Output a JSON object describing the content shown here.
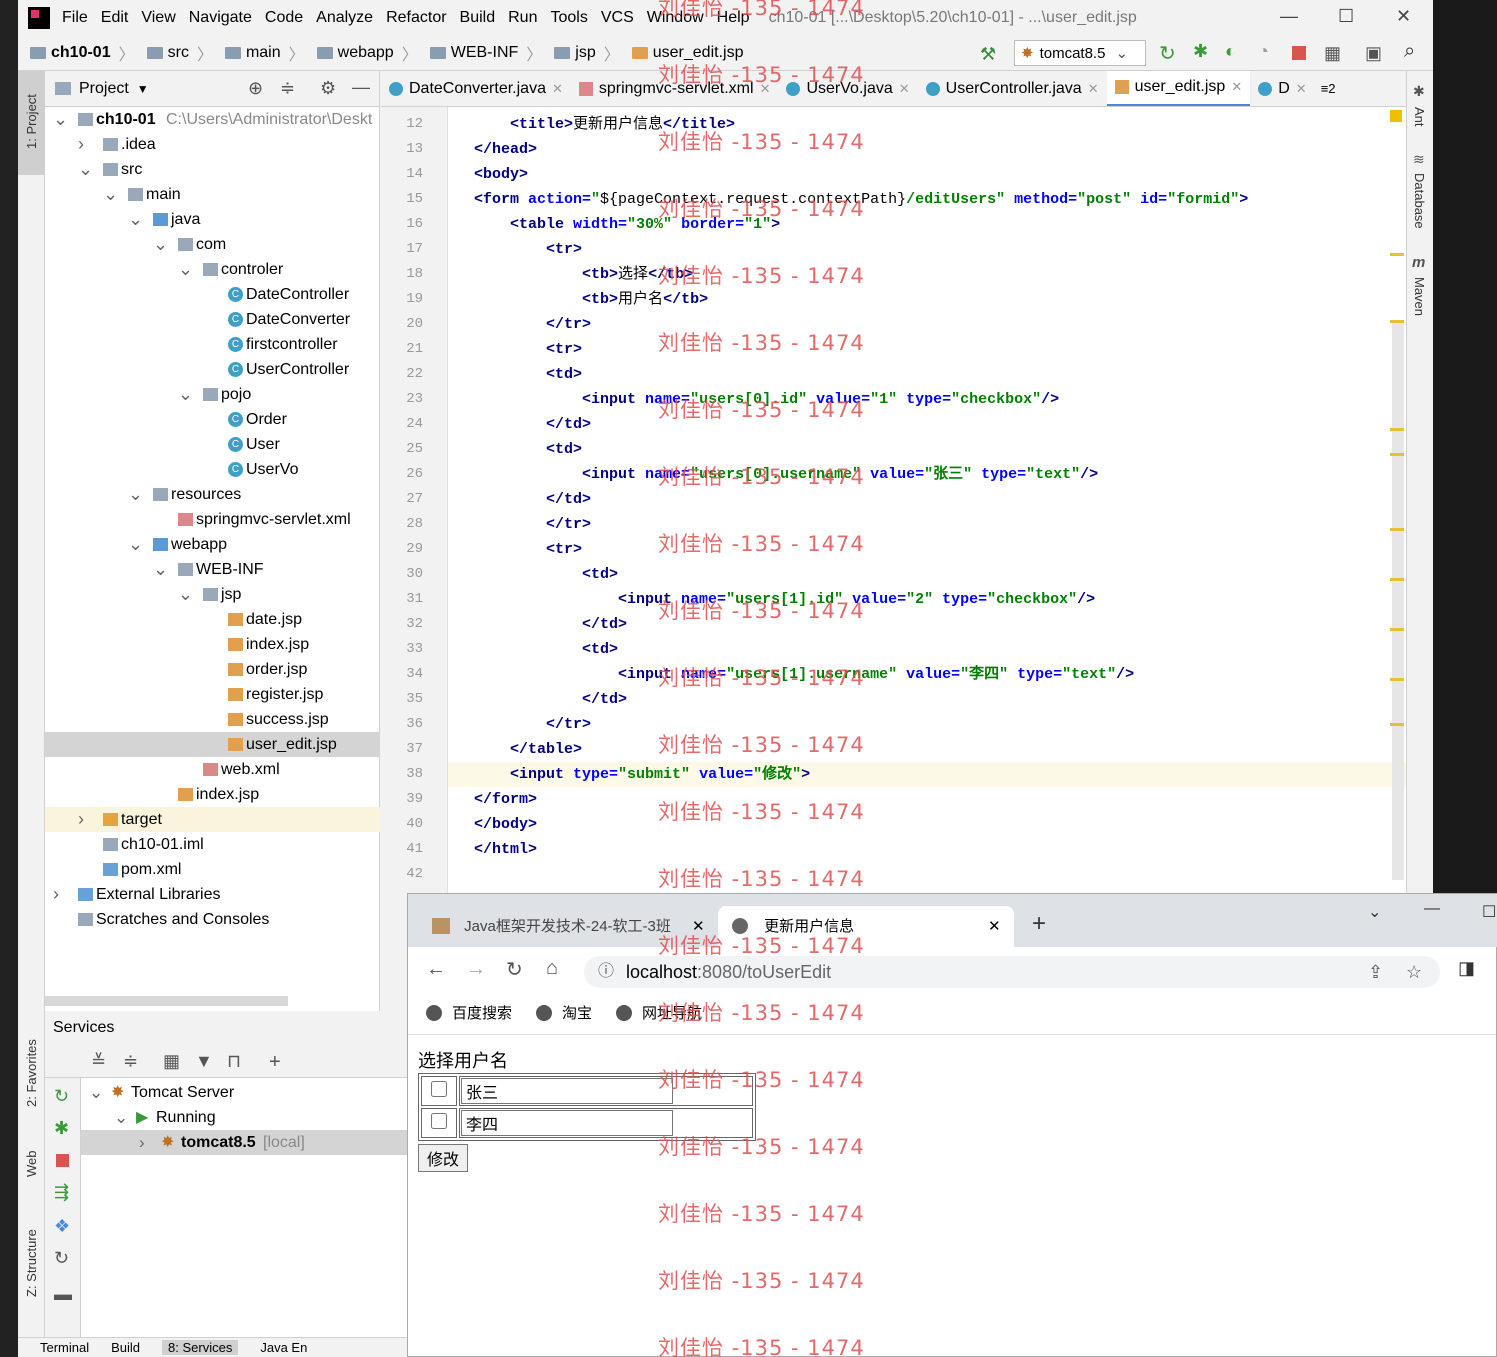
{
  "menubar": {
    "items": [
      "File",
      "Edit",
      "View",
      "Navigate",
      "Code",
      "Analyze",
      "Refactor",
      "Build",
      "Run",
      "Tools",
      "VCS",
      "Window",
      "Help"
    ],
    "title": "ch10-01 [...\\Desktop\\5.20\\ch10-01] - ...\\user_edit.jsp"
  },
  "breadcrumb": [
    "ch10-01",
    "src",
    "main",
    "webapp",
    "WEB-INF",
    "jsp",
    "user_edit.jsp"
  ],
  "run_config": "tomcat8.5",
  "project_panel": {
    "title": "Project",
    "tree": [
      {
        "label": "ch10-01",
        "extra": "C:\\Users\\Administrator\\Deskt",
        "indent": 0,
        "arrow": "v",
        "icon": "folder",
        "bold": true
      },
      {
        "label": ".idea",
        "indent": 1,
        "arrow": ">",
        "icon": "folder"
      },
      {
        "label": "src",
        "indent": 1,
        "arrow": "v",
        "icon": "folder"
      },
      {
        "label": "main",
        "indent": 2,
        "arrow": "v",
        "icon": "folder"
      },
      {
        "label": "java",
        "indent": 3,
        "arrow": "v",
        "icon": "folder-blue"
      },
      {
        "label": "com",
        "indent": 4,
        "arrow": "v",
        "icon": "folder"
      },
      {
        "label": "controler",
        "indent": 5,
        "arrow": "v",
        "icon": "folder"
      },
      {
        "label": "DateController",
        "indent": 6,
        "icon": "class"
      },
      {
        "label": "DateConverter",
        "indent": 6,
        "icon": "class"
      },
      {
        "label": "firstcontroller",
        "indent": 6,
        "icon": "class"
      },
      {
        "label": "UserController",
        "indent": 6,
        "icon": "class"
      },
      {
        "label": "pojo",
        "indent": 5,
        "arrow": "v",
        "icon": "folder"
      },
      {
        "label": "Order",
        "indent": 6,
        "icon": "class"
      },
      {
        "label": "User",
        "indent": 6,
        "icon": "class"
      },
      {
        "label": "UserVo",
        "indent": 6,
        "icon": "class"
      },
      {
        "label": "resources",
        "indent": 3,
        "arrow": "v",
        "icon": "folder"
      },
      {
        "label": "springmvc-servlet.xml",
        "indent": 4,
        "icon": "xml"
      },
      {
        "label": "webapp",
        "indent": 3,
        "arrow": "v",
        "icon": "folder-blue"
      },
      {
        "label": "WEB-INF",
        "indent": 4,
        "arrow": "v",
        "icon": "folder"
      },
      {
        "label": "jsp",
        "indent": 5,
        "arrow": "v",
        "icon": "folder"
      },
      {
        "label": "date.jsp",
        "indent": 6,
        "icon": "jsp"
      },
      {
        "label": "index.jsp",
        "indent": 6,
        "icon": "jsp"
      },
      {
        "label": "order.jsp",
        "indent": 6,
        "icon": "jsp"
      },
      {
        "label": "register.jsp",
        "indent": 6,
        "icon": "jsp"
      },
      {
        "label": "success.jsp",
        "indent": 6,
        "icon": "jsp"
      },
      {
        "label": "user_edit.jsp",
        "indent": 6,
        "icon": "jsp",
        "selected": true
      },
      {
        "label": "web.xml",
        "indent": 5,
        "icon": "xml"
      },
      {
        "label": "index.jsp",
        "indent": 4,
        "icon": "jsp"
      },
      {
        "label": "target",
        "indent": 1,
        "arrow": ">",
        "icon": "folder-orange",
        "target": true
      },
      {
        "label": "ch10-01.iml",
        "indent": 1,
        "icon": "file"
      },
      {
        "label": "pom.xml",
        "indent": 1,
        "icon": "maven"
      },
      {
        "label": "External Libraries",
        "indent": 0,
        "arrow": ">",
        "icon": "lib"
      },
      {
        "label": "Scratches and Consoles",
        "indent": 0,
        "icon": "scratch"
      }
    ]
  },
  "editor_tabs": [
    {
      "label": "DateConverter.java",
      "icon": "class"
    },
    {
      "label": "springmvc-servlet.xml",
      "icon": "xml"
    },
    {
      "label": "UserVo.java",
      "icon": "class"
    },
    {
      "label": "UserController.java",
      "icon": "class"
    },
    {
      "label": "user_edit.jsp",
      "icon": "jsp",
      "active": true
    },
    {
      "label": "D",
      "icon": "class"
    }
  ],
  "tabs_overflow": "≡2",
  "code_lines": [
    {
      "n": "12",
      "segs": [
        [
          "i",
          "    "
        ],
        [
          "tag",
          "<title>"
        ],
        [
          "txt",
          "更新用户信息"
        ],
        [
          "tag",
          "</title>"
        ]
      ]
    },
    {
      "n": "13",
      "segs": [
        [
          "tag",
          "</head>"
        ]
      ]
    },
    {
      "n": "14",
      "segs": [
        [
          "tag",
          "<body>"
        ]
      ]
    },
    {
      "n": "15",
      "segs": [
        [
          "tag",
          "<form "
        ],
        [
          "attr",
          "action="
        ],
        [
          "val",
          "\""
        ],
        [
          "txt",
          "${pageContext.request.contextPath}"
        ],
        [
          "val",
          "/editUsers\" "
        ],
        [
          "attr",
          "method="
        ],
        [
          "val",
          "\"post\" "
        ],
        [
          "attr",
          "id="
        ],
        [
          "val",
          "\"formid\""
        ],
        [
          "tag",
          ">"
        ]
      ]
    },
    {
      "n": "16",
      "segs": [
        [
          "i",
          "    "
        ],
        [
          "tag",
          "<table "
        ],
        [
          "attr",
          "width="
        ],
        [
          "val",
          "\"30%\" "
        ],
        [
          "attr",
          "border="
        ],
        [
          "val",
          "\"1\""
        ],
        [
          "tag",
          ">"
        ]
      ]
    },
    {
      "n": "17",
      "segs": [
        [
          "i",
          "        "
        ],
        [
          "tag",
          "<tr>"
        ]
      ]
    },
    {
      "n": "18",
      "segs": [
        [
          "i",
          "            "
        ],
        [
          "tag",
          "<tb>"
        ],
        [
          "txt",
          "选择"
        ],
        [
          "tag",
          "</tb>"
        ]
      ]
    },
    {
      "n": "19",
      "segs": [
        [
          "i",
          "            "
        ],
        [
          "tag",
          "<tb>"
        ],
        [
          "txt",
          "用户名"
        ],
        [
          "tag",
          "</tb>"
        ]
      ]
    },
    {
      "n": "20",
      "segs": [
        [
          "i",
          "        "
        ],
        [
          "tag",
          "</tr>"
        ]
      ]
    },
    {
      "n": "21",
      "segs": [
        [
          "i",
          "        "
        ],
        [
          "tag",
          "<tr>"
        ]
      ]
    },
    {
      "n": "22",
      "segs": [
        [
          "i",
          "        "
        ],
        [
          "tag",
          "<td>"
        ]
      ]
    },
    {
      "n": "23",
      "segs": [
        [
          "i",
          "            "
        ],
        [
          "tag",
          "<input "
        ],
        [
          "attr",
          "name="
        ],
        [
          "val",
          "\"users[0].id\" "
        ],
        [
          "attr",
          "value="
        ],
        [
          "val",
          "\"1\" "
        ],
        [
          "attr",
          "type="
        ],
        [
          "val",
          "\"checkbox\""
        ],
        [
          "tag",
          "/>"
        ]
      ]
    },
    {
      "n": "24",
      "segs": [
        [
          "i",
          "        "
        ],
        [
          "tag",
          "</td>"
        ]
      ]
    },
    {
      "n": "25",
      "segs": [
        [
          "i",
          "        "
        ],
        [
          "tag",
          "<td>"
        ]
      ]
    },
    {
      "n": "26",
      "segs": [
        [
          "i",
          "            "
        ],
        [
          "tag",
          "<input "
        ],
        [
          "attr",
          "name="
        ],
        [
          "val",
          "\"users[0].username\" "
        ],
        [
          "attr",
          "value="
        ],
        [
          "val",
          "\"张三\" "
        ],
        [
          "attr",
          "type="
        ],
        [
          "val",
          "\"text\""
        ],
        [
          "tag",
          "/>"
        ]
      ]
    },
    {
      "n": "27",
      "segs": [
        [
          "i",
          "        "
        ],
        [
          "tag",
          "</td>"
        ]
      ]
    },
    {
      "n": "28",
      "segs": [
        [
          "i",
          "        "
        ],
        [
          "tag",
          "</tr>"
        ]
      ]
    },
    {
      "n": "29",
      "segs": [
        [
          "i",
          "        "
        ],
        [
          "tag",
          "<tr>"
        ]
      ]
    },
    {
      "n": "30",
      "segs": [
        [
          "i",
          "            "
        ],
        [
          "tag",
          "<td>"
        ]
      ]
    },
    {
      "n": "31",
      "segs": [
        [
          "i",
          "                "
        ],
        [
          "tag",
          "<input "
        ],
        [
          "attr",
          "name="
        ],
        [
          "val",
          "\"users[1].id\" "
        ],
        [
          "attr",
          "value="
        ],
        [
          "val",
          "\"2\" "
        ],
        [
          "attr",
          "type="
        ],
        [
          "val",
          "\"checkbox\""
        ],
        [
          "tag",
          "/>"
        ]
      ]
    },
    {
      "n": "32",
      "segs": [
        [
          "i",
          "            "
        ],
        [
          "tag",
          "</td>"
        ]
      ]
    },
    {
      "n": "33",
      "segs": [
        [
          "i",
          "            "
        ],
        [
          "tag",
          "<td>"
        ]
      ]
    },
    {
      "n": "34",
      "segs": [
        [
          "i",
          "                "
        ],
        [
          "tag",
          "<input "
        ],
        [
          "attr",
          "name="
        ],
        [
          "val",
          "\"users[1].username\" "
        ],
        [
          "attr",
          "value="
        ],
        [
          "val",
          "\"李四\" "
        ],
        [
          "attr",
          "type="
        ],
        [
          "val",
          "\"text\""
        ],
        [
          "tag",
          "/>"
        ]
      ]
    },
    {
      "n": "35",
      "segs": [
        [
          "i",
          "            "
        ],
        [
          "tag",
          "</td>"
        ]
      ]
    },
    {
      "n": "36",
      "segs": [
        [
          "i",
          "        "
        ],
        [
          "tag",
          "</tr>"
        ]
      ]
    },
    {
      "n": "37",
      "segs": [
        [
          "i",
          "    "
        ],
        [
          "tag",
          "</table>"
        ]
      ]
    },
    {
      "n": "38",
      "segs": [
        [
          "i",
          "    "
        ],
        [
          "tag",
          "<input "
        ],
        [
          "attr",
          "type="
        ],
        [
          "val",
          "\"submit\" "
        ],
        [
          "attr",
          "value="
        ],
        [
          "val",
          "\"修改\""
        ],
        [
          "tag",
          ">"
        ]
      ],
      "current": true
    },
    {
      "n": "39",
      "segs": [
        [
          "tag",
          "</form>"
        ]
      ]
    },
    {
      "n": "40",
      "segs": [
        [
          "tag",
          "</body>"
        ]
      ]
    },
    {
      "n": "41",
      "segs": [
        [
          "tag",
          "</html>"
        ]
      ]
    },
    {
      "n": "42",
      "segs": []
    }
  ],
  "right_tools": [
    "Ant",
    "Database",
    "Maven"
  ],
  "left_tools": [
    "1: Project",
    "2: Favorites",
    "Web",
    "Z: Structure"
  ],
  "services": {
    "title": "Services",
    "rows": [
      {
        "label": "Tomcat Server",
        "indent": 0
      },
      {
        "label": "Running",
        "indent": 1
      },
      {
        "label": "tomcat8.5",
        "suffix": "[local]",
        "indent": 2,
        "selected": true
      }
    ]
  },
  "bottom_tabs": [
    "Terminal",
    "Build",
    "8: Services",
    "Java En"
  ],
  "browser": {
    "tabs": [
      {
        "label": "Java框架开发技术-24-软工-3班"
      },
      {
        "label": "更新用户信息",
        "active": true
      }
    ],
    "url_host": "localhost",
    "url_rest": ":8080/toUserEdit",
    "bookmarks": [
      "百度搜索",
      "淘宝",
      "网址导航"
    ],
    "page": {
      "header_text": "选择用户名",
      "rows": [
        {
          "checked": false,
          "name": "张三"
        },
        {
          "checked": false,
          "name": "李四"
        }
      ],
      "submit_label": "修改"
    }
  },
  "watermark": "刘佳怡 -135 - 1474"
}
